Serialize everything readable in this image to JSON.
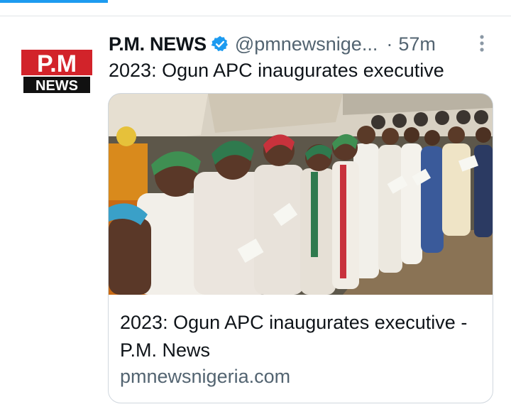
{
  "tweet": {
    "account_name": "P.M. NEWS",
    "handle": "@pmnewsnige...",
    "separator": "·",
    "time": "57m",
    "text": "2023: Ogun APC inaugurates executive",
    "avatar_logo": {
      "line1": "P.M",
      "line2": "NEWS"
    }
  },
  "card": {
    "title": "2023: Ogun APC inaugurates executive - P.M. News",
    "domain": "pmnewsnigeria.com"
  },
  "colors": {
    "accent": "#1d9bf0",
    "logo_red": "#d2232a",
    "logo_black": "#111111",
    "text_primary": "#0f1419",
    "text_secondary": "#536471"
  },
  "icons": [
    "verified-badge-icon",
    "more-options-icon"
  ]
}
